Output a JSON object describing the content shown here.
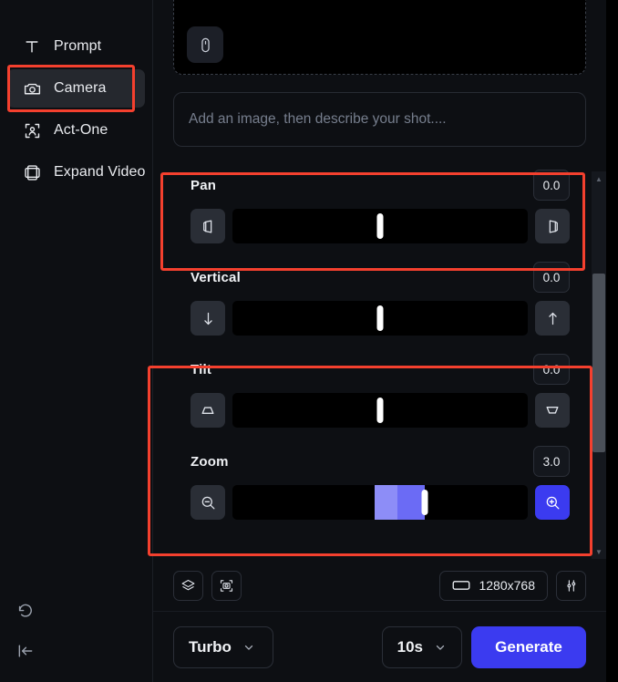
{
  "sidebar": {
    "items": [
      {
        "label": "Prompt",
        "icon": "text-icon",
        "active": false
      },
      {
        "label": "Camera",
        "icon": "camera-icon",
        "active": true
      },
      {
        "label": "Act-One",
        "icon": "person-frame-icon",
        "active": false
      },
      {
        "label": "Expand Video",
        "icon": "expand-frames-icon",
        "active": false
      }
    ],
    "bottom": [
      {
        "name": "history-undo-icon"
      },
      {
        "name": "collapse-sidebar-icon"
      }
    ]
  },
  "upload": {
    "button_icon": "mouse-device-icon"
  },
  "prompt": {
    "placeholder": "Add an image, then describe your shot...."
  },
  "controls": [
    {
      "label": "Pan",
      "value": "0.0",
      "thumb_percent": 50,
      "fill_percent": 0,
      "left_icon": "pan-left-icon",
      "right_icon": "pan-right-icon",
      "right_active": false
    },
    {
      "label": "Vertical",
      "value": "0.0",
      "thumb_percent": 50,
      "fill_percent": 0,
      "left_icon": "arrow-down-icon",
      "right_icon": "arrow-up-icon",
      "right_active": false
    },
    {
      "label": "Tilt",
      "value": "0.0",
      "thumb_percent": 50,
      "fill_percent": 0,
      "left_icon": "tilt-down-icon",
      "right_icon": "tilt-up-icon",
      "right_active": false
    },
    {
      "label": "Zoom",
      "value": "3.0",
      "thumb_percent": 65,
      "fill_percent": 65,
      "fill_split_percent": 48,
      "left_icon": "zoom-out-icon",
      "right_icon": "zoom-in-icon",
      "right_active": true
    }
  ],
  "toolbar": {
    "layers_icon": "layers-icon",
    "frame_icon": "camera-focus-icon",
    "resolution_icon": "rectangle-icon",
    "resolution": "1280x768",
    "settings_icon": "sliders-icon"
  },
  "bottombar": {
    "model": "Turbo",
    "model_chevron": "chevron-down-icon",
    "duration": "10s",
    "duration_chevron": "chevron-down-icon",
    "generate": "Generate"
  },
  "colors": {
    "accent": "#3b3bf0",
    "slider_fill_light": "#8d8df7",
    "slider_fill": "#6b6bf5",
    "annotation": "#f4402e",
    "panel_bg": "#0d0f13",
    "track_bg": "#000000"
  }
}
